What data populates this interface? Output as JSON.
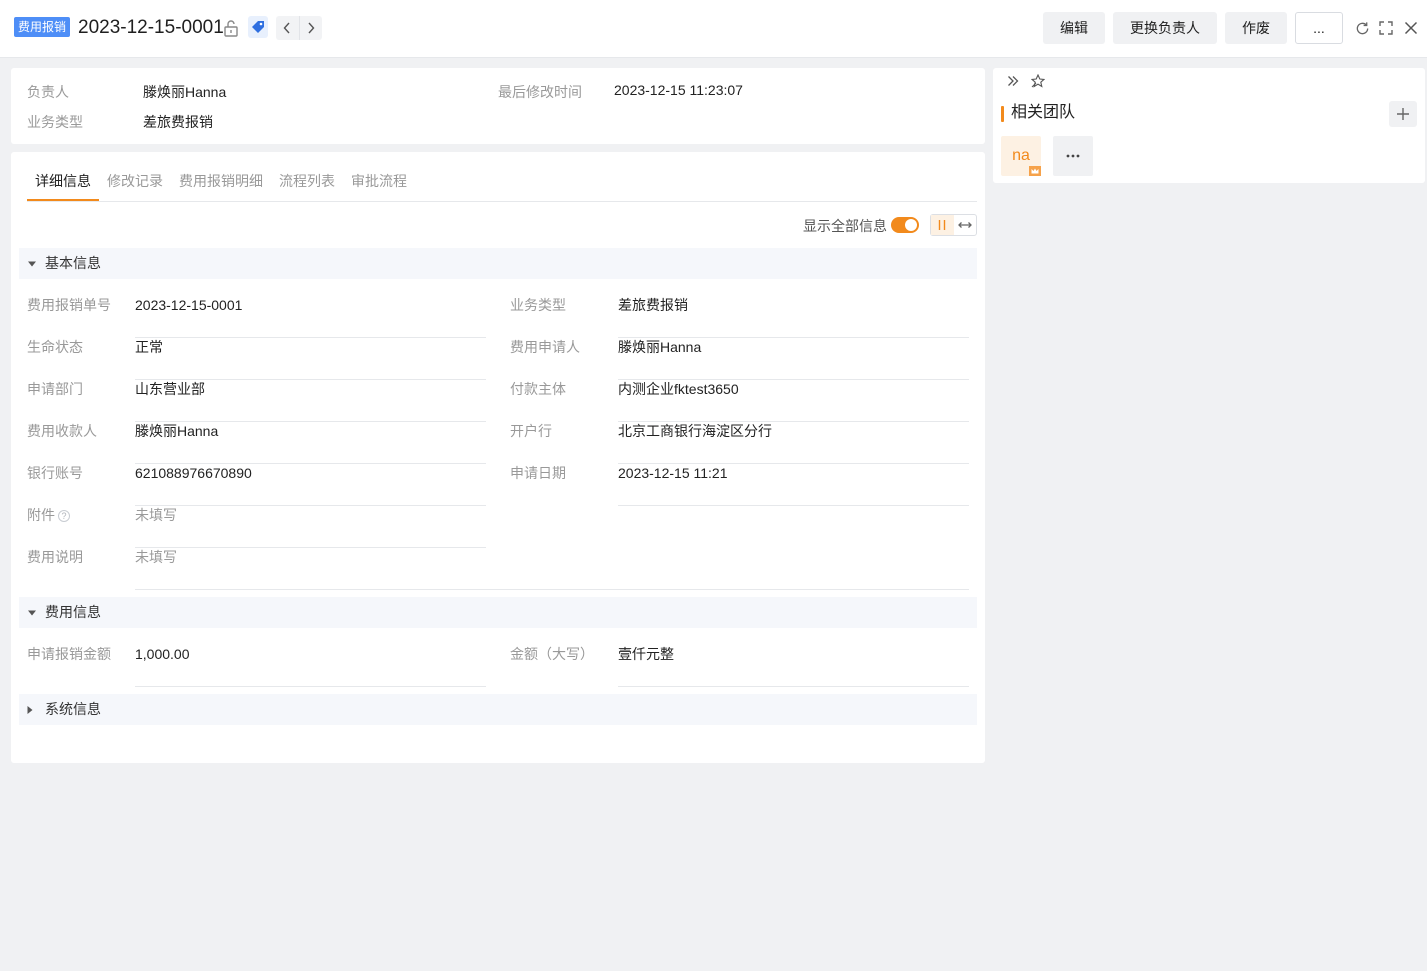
{
  "header": {
    "object_badge": "费用报销",
    "record_no": "2023-12-15-0001",
    "buttons": {
      "edit": "编辑",
      "change_owner": "更换负责人",
      "void": "作废",
      "more": "..."
    }
  },
  "summary": {
    "owner_label": "负责人",
    "owner_value": "滕焕丽Hanna",
    "modified_label": "最后修改时间",
    "modified_value": "2023-12-15 11:23:07",
    "biz_type_label": "业务类型",
    "biz_type_value": "差旅费报销"
  },
  "tabs": [
    "详细信息",
    "修改记录",
    "费用报销明细",
    "流程列表",
    "审批流程"
  ],
  "show_all": {
    "label": "显示全部信息",
    "enabled": true
  },
  "sections": {
    "basic": {
      "title": "基本信息",
      "expanded": true,
      "left": [
        {
          "label": "费用报销单号",
          "value": "2023-12-15-0001"
        },
        {
          "label": "生命状态",
          "value": "正常"
        },
        {
          "label": "申请部门",
          "value": "山东营业部"
        },
        {
          "label": "费用收款人",
          "value": "滕焕丽Hanna"
        },
        {
          "label": "银行账号",
          "value": "621088976670890"
        },
        {
          "label": "附件",
          "value": "未填写",
          "help": "?"
        },
        {
          "label": "费用说明",
          "value": "未填写"
        }
      ],
      "right": [
        {
          "label": "业务类型",
          "value": "差旅费报销"
        },
        {
          "label": "费用申请人",
          "value": "滕焕丽Hanna"
        },
        {
          "label": "付款主体",
          "value": "内测企业fktest3650"
        },
        {
          "label": "开户行",
          "value": "北京工商银行海淀区分行"
        },
        {
          "label": "申请日期",
          "value": "2023-12-15 11:21"
        }
      ]
    },
    "fee": {
      "title": "费用信息",
      "expanded": true,
      "left": [
        {
          "label": "申请报销金额",
          "value": "1,000.00"
        }
      ],
      "right": [
        {
          "label": "金额（大写）",
          "value": "壹仟元整"
        }
      ]
    },
    "system": {
      "title": "系统信息",
      "expanded": false
    }
  },
  "side_panel": {
    "team_title": "相关团队",
    "member_initials": "na"
  },
  "colors": {
    "accent": "#f28a1c",
    "badge": "#4e8ef7",
    "section_bg": "#f5f7fb"
  }
}
